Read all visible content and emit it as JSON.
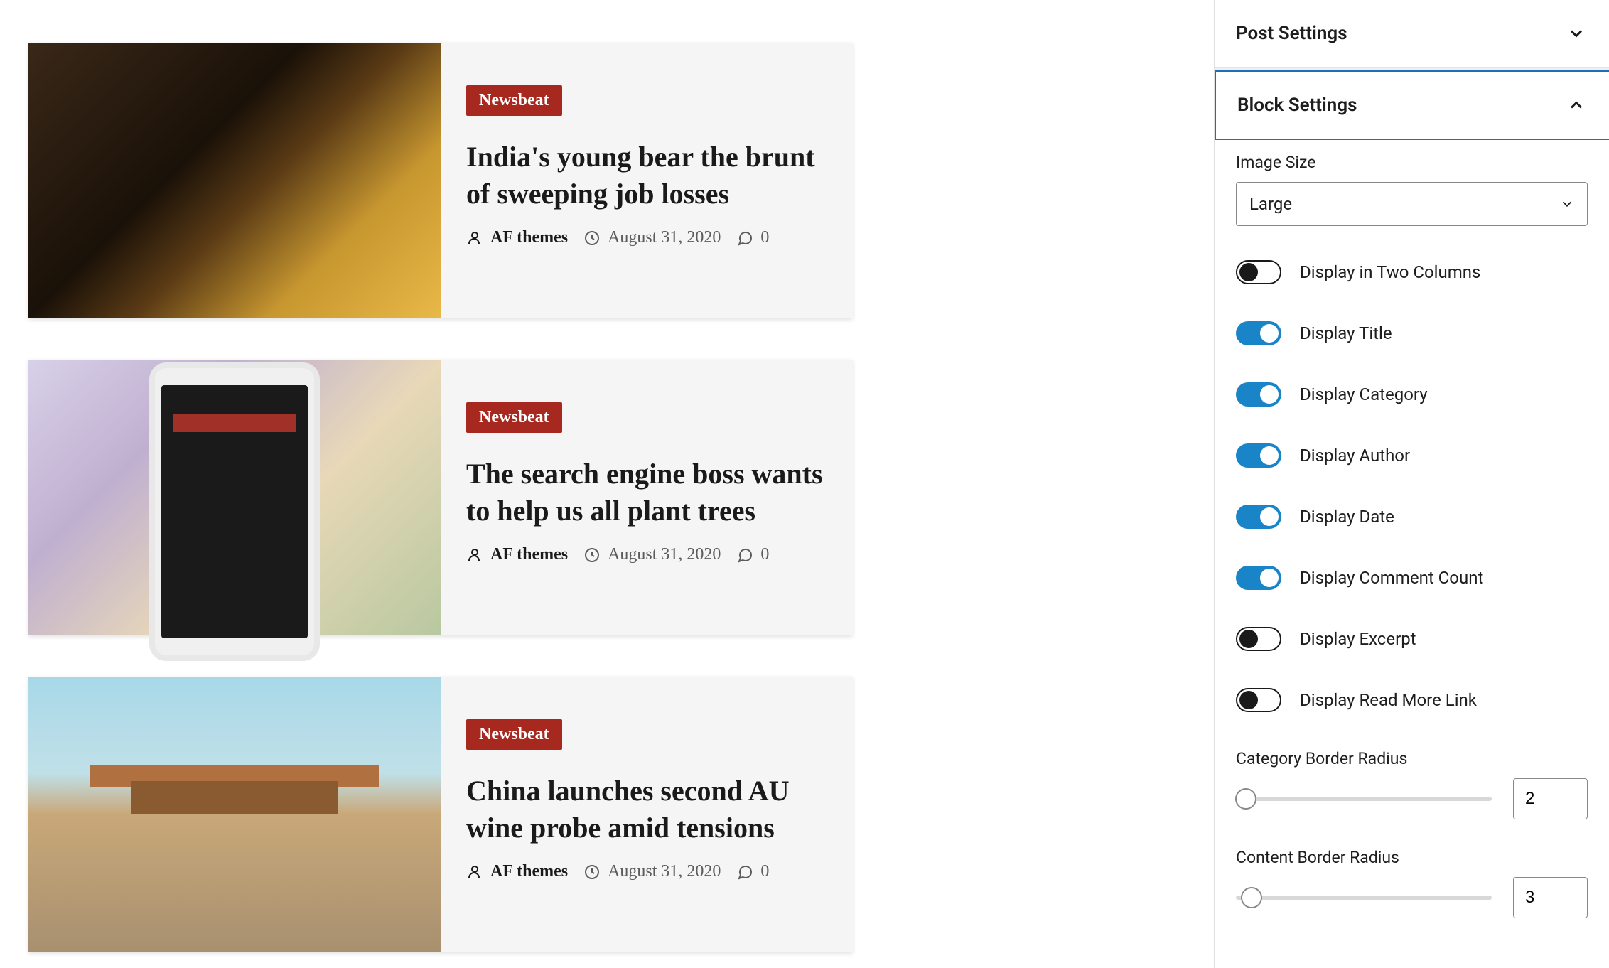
{
  "posts": [
    {
      "category": "Newsbeat",
      "title": "India's young bear the brunt of sweeping job losses",
      "author": "AF themes",
      "date": "August 31, 2020",
      "comments": "0"
    },
    {
      "category": "Newsbeat",
      "title": "The search engine boss wants to help us all plant trees",
      "author": "AF themes",
      "date": "August 31, 2020",
      "comments": "0"
    },
    {
      "category": "Newsbeat",
      "title": "China launches second AU wine probe amid tensions",
      "author": "AF themes",
      "date": "August 31, 2020",
      "comments": "0"
    }
  ],
  "sidebar": {
    "post_settings_label": "Post Settings",
    "block_settings_label": "Block Settings",
    "image_size_label": "Image Size",
    "image_size_value": "Large",
    "toggles": {
      "two_columns": {
        "label": "Display in Two Columns",
        "on": false
      },
      "title": {
        "label": "Display Title",
        "on": true
      },
      "category": {
        "label": "Display Category",
        "on": true
      },
      "author": {
        "label": "Display Author",
        "on": true
      },
      "date": {
        "label": "Display Date",
        "on": true
      },
      "comment_count": {
        "label": "Display Comment Count",
        "on": true
      },
      "excerpt": {
        "label": "Display Excerpt",
        "on": false
      },
      "read_more": {
        "label": "Display Read More Link",
        "on": false
      }
    },
    "category_radius_label": "Category Border Radius",
    "category_radius_value": "2",
    "content_radius_label": "Content Border Radius",
    "content_radius_value": "3"
  }
}
